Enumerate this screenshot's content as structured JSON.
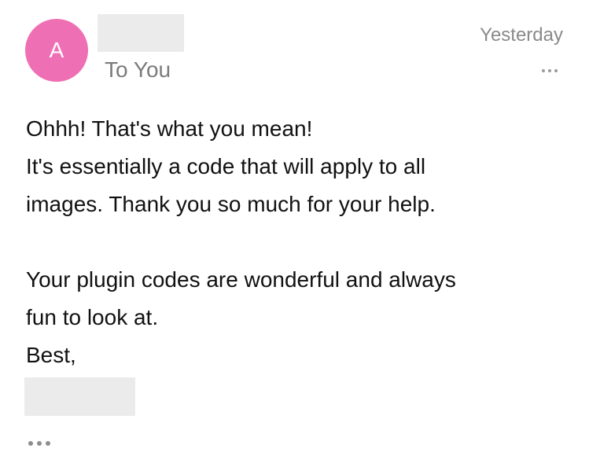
{
  "header": {
    "avatar_initial": "A",
    "recipient": "To You",
    "date": "Yesterday"
  },
  "icons": {
    "more_top": "more-horizontal-icon",
    "more_bottom": "more-horizontal-icon"
  },
  "colors": {
    "avatar": "#ef6fb4",
    "redaction": "#ebebeb",
    "secondary_text": "#7b7b7b"
  },
  "message": {
    "lines": [
      "Ohhh! That's what you mean!",
      "It's essentially a code that will apply to all",
      "images. Thank you so much for your help.",
      "Your plugin codes are wonderful and always",
      "fun to look at.",
      "Best,"
    ]
  }
}
